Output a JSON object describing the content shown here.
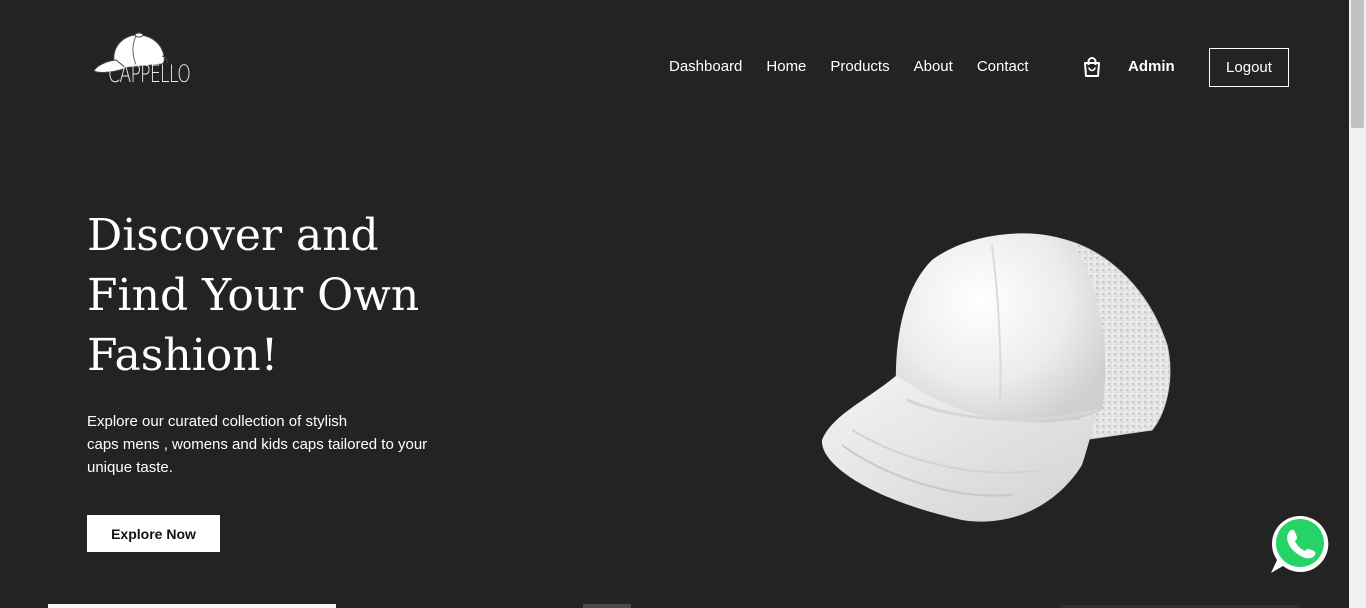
{
  "brand": {
    "logo_text": "CAPPELLO",
    "logo_icon": "cap-icon"
  },
  "nav": {
    "items": [
      {
        "label": "Dashboard"
      },
      {
        "label": "Home"
      },
      {
        "label": "Products"
      },
      {
        "label": "About"
      },
      {
        "label": "Contact"
      }
    ],
    "cart_icon": "shopping-bag-icon",
    "user_label": "Admin",
    "logout_label": "Logout"
  },
  "hero": {
    "title_lines": [
      "Discover and",
      "Find Your Own",
      "Fashion!"
    ],
    "description_lines": [
      "Explore our curated collection of stylish",
      "caps mens , womens and kids caps tailored to your",
      "unique taste."
    ],
    "cta_label": "Explore Now",
    "image_icon": "white-trucker-cap-image"
  },
  "floating": {
    "chat_icon": "whatsapp-icon"
  },
  "colors": {
    "background": "#232323",
    "text": "#ffffff",
    "button_bg": "#ffffff",
    "whatsapp_green": "#25d366"
  }
}
